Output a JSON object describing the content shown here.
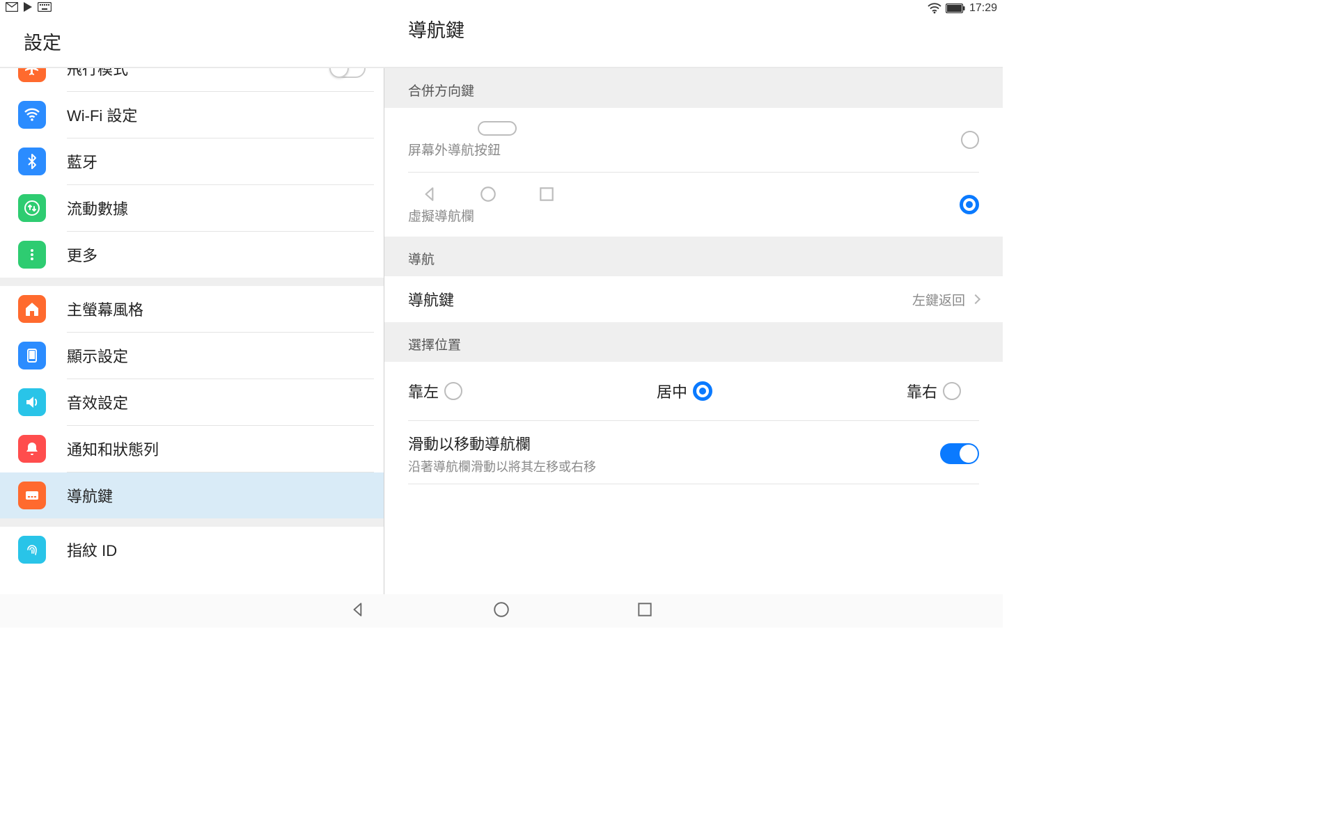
{
  "status": {
    "time": "17:29"
  },
  "sidebar": {
    "title": "設定",
    "items": [
      {
        "label": "飛行模式"
      },
      {
        "label": "Wi-Fi 設定"
      },
      {
        "label": "藍牙"
      },
      {
        "label": "流動數據"
      },
      {
        "label": "更多"
      },
      {
        "label": "主螢幕風格"
      },
      {
        "label": "顯示設定"
      },
      {
        "label": "音效設定"
      },
      {
        "label": "通知和狀態列"
      },
      {
        "label": "導航鍵"
      },
      {
        "label": "指紋 ID"
      }
    ]
  },
  "detail": {
    "title": "導航鍵",
    "sections": {
      "combine": "合併方向鍵",
      "nav": "導航",
      "position": "選擇位置"
    },
    "options": {
      "offscreen_btn_caption": "屏幕外導航按鈕",
      "virtual_bar_caption": "虛擬導航欄",
      "nav_keys_label": "導航鍵",
      "nav_keys_value": "左鍵返回"
    },
    "position": {
      "left": "靠左",
      "center": "居中",
      "right": "靠右",
      "selected": "center"
    },
    "slide": {
      "title": "滑動以移動導航欄",
      "desc": "沿著導航欄滑動以將其左移或右移"
    }
  }
}
